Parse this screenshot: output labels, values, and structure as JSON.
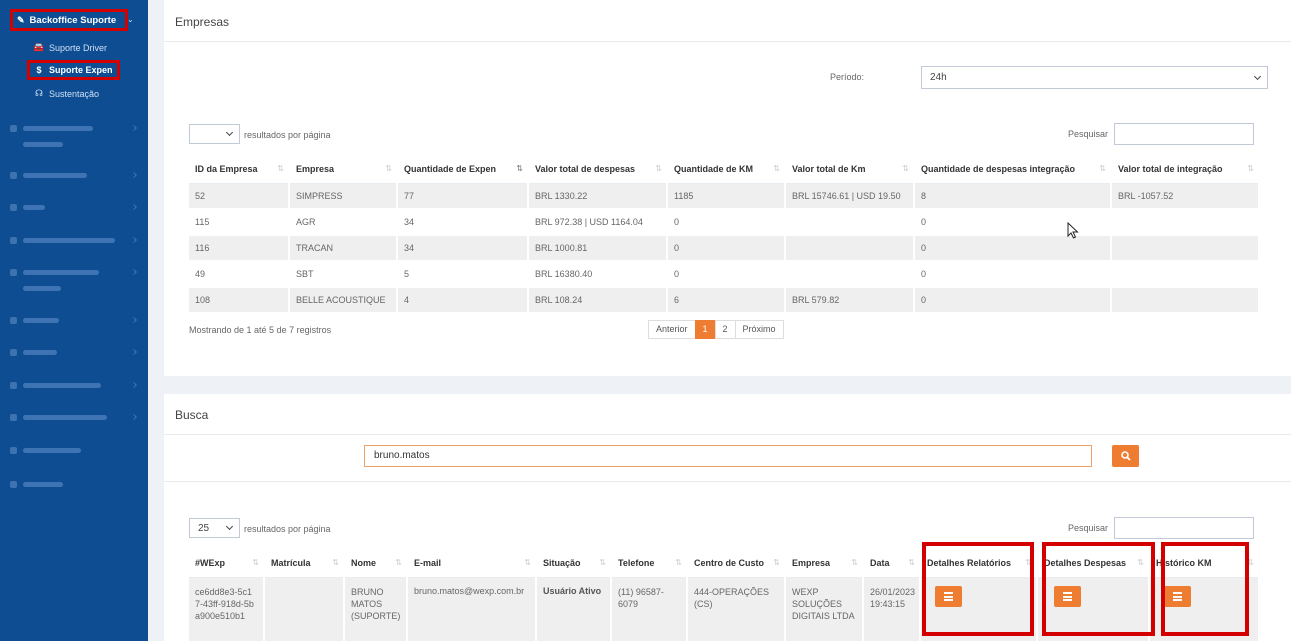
{
  "sidebar": {
    "main_item": "Backoffice Suporte",
    "sub_items": [
      {
        "label": "Suporte Driver",
        "icon": "car-icon"
      },
      {
        "label": "Suporte Expen",
        "icon": "dollar-icon"
      },
      {
        "label": "Sustentação",
        "icon": "headset-icon"
      }
    ]
  },
  "empresas": {
    "title": "Empresas",
    "periodo_label": "Período:",
    "periodo_value": "24h",
    "page_size_value": "",
    "page_size_label": "resultados por página",
    "search_label": "Pesquisar",
    "columns": [
      "ID da Empresa",
      "Empresa",
      "Quantidade de Expen",
      "Valor total de despesas",
      "Quantidade de KM",
      "Valor total de Km",
      "Quantidade de despesas integração",
      "Valor total de integração"
    ],
    "rows": [
      [
        "52",
        "SIMPRESS",
        "77",
        "BRL 1330.22",
        "1185",
        "BRL 15746.61 | USD 19.50",
        "8",
        "BRL -1057.52"
      ],
      [
        "115",
        "AGR",
        "34",
        "BRL 972.38 | USD 1164.04",
        "0",
        "",
        "0",
        ""
      ],
      [
        "116",
        "TRACAN",
        "34",
        "BRL 1000.81",
        "0",
        "",
        "0",
        ""
      ],
      [
        "49",
        "SBT",
        "5",
        "BRL 16380.40",
        "0",
        "",
        "0",
        ""
      ],
      [
        "108",
        "BELLE ACOUSTIQUE",
        "4",
        "BRL 108.24",
        "6",
        "BRL 579.82",
        "0",
        ""
      ]
    ],
    "info": "Mostrando de 1 até 5 de 7 registros",
    "pager": {
      "prev": "Anterior",
      "pages": [
        "1",
        "2"
      ],
      "current": "1",
      "next": "Próximo"
    }
  },
  "busca": {
    "title": "Busca",
    "query": "bruno.matos",
    "page_size_value": "25",
    "page_size_label": "resultados por página",
    "search_label": "Pesquisar",
    "columns": [
      "#WExp",
      "Matrícula",
      "Nome",
      "E-mail",
      "Situação",
      "Telefone",
      "Centro de Custo",
      "Empresa",
      "Data",
      "Detalhes Relatórios",
      "Detalhes Despesas",
      "Histórico KM"
    ],
    "row": {
      "wexp": "ce6dd8e3-5c17-43ff-918d-5ba900e510b1",
      "matricula": "",
      "nome": "BRUNO MATOS (SUPORTE)",
      "email": "bruno.matos@wexp.com.br",
      "situacao": "Usuário Ativo",
      "telefone": "(11) 96587-6079",
      "centro_custo": "444-OPERAÇÕES (CS)",
      "empresa": "WEXP SOLUÇÕES DIGITAIS LTDA",
      "data": "26/01/2023 19:43:15"
    }
  },
  "colors": {
    "sidebar": "#0e4d92",
    "accent": "#ef7d31",
    "highlight": "#d40000"
  }
}
